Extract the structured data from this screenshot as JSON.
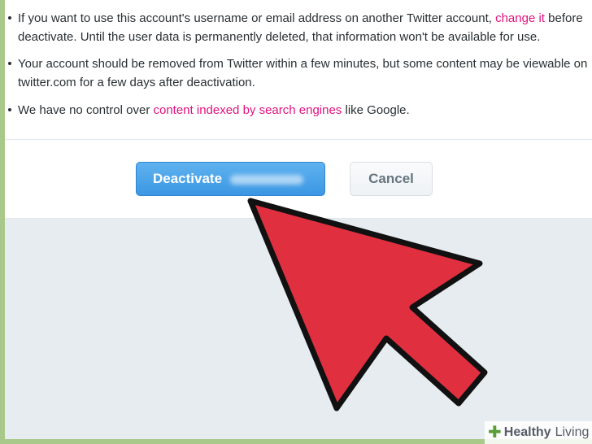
{
  "bullets": [
    {
      "line1_pre": "If you want to use this account's username or email address on another Twitter account, ",
      "line1_link": "change it",
      "line1_post": " before",
      "line2": "deactivate. Until the user data is permanently deleted, that information won't be available for use."
    },
    {
      "line1": "Your account should be removed from Twitter within a few minutes, but some content may be viewable on",
      "line2": "twitter.com for a few days after deactivation."
    },
    {
      "pre": "We have no control over ",
      "link": "content indexed by search engines",
      "post": " like Google."
    }
  ],
  "buttons": {
    "deactivate_label": "Deactivate",
    "cancel_label": "Cancel"
  },
  "watermark": {
    "healthy": "Healthy",
    "living": "Living"
  },
  "colors": {
    "link": "#e0127e",
    "deactivate": "#3b97e3",
    "arrow": "#e03040",
    "background": "#e6ecf0"
  },
  "icons": {
    "arrow": "pointer-arrow-icon",
    "watermark_cross": "plus-cross-icon"
  }
}
